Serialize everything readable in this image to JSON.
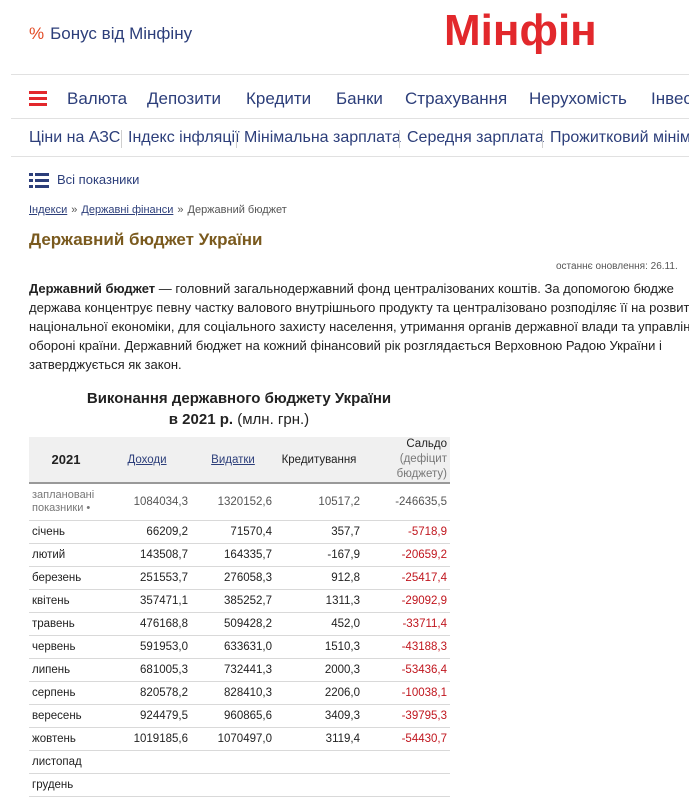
{
  "header": {
    "bonus_symbol": "%",
    "bonus_label": "Бонус від Мінфіну",
    "logo": "Мінфін",
    "brand_color": "#e2282c"
  },
  "nav_primary": [
    "Валюта",
    "Депозити",
    "Кредити",
    "Банки",
    "Страхування",
    "Нерухомість",
    "Інвес"
  ],
  "nav_secondary": [
    "Ціни на АЗС",
    "Індекс інфляції",
    "Мінімальна зарплата",
    "Середня зарплата",
    "Прожитковий мінім"
  ],
  "all_indicators": "Всі показники",
  "breadcrumbs": [
    "Індекси",
    "Державні фінанси",
    "Державний бюджет"
  ],
  "breadcrumb_sep": "»",
  "page_title": "Державний бюджет України",
  "updated": "останнє оновлення: 26.11.",
  "description": {
    "term": "Державний бюджет",
    "text_1": " — головний загальнодержавний фонд централізованих коштів. За допомогою бюдже",
    "text_2": "держава концентрує певну частку валового внутрішнього продукту та централізовано розподіляє її на розвито",
    "text_3": "національної економіки, для соціального захисту населення, утримання органів державної влади та управлінн",
    "text_4": "обороні країни. Державний бюджет на кожний фінансовий рік розглядається Верховною Радою України і",
    "text_5": "затверджується як закон."
  },
  "table": {
    "caption_line1": "Виконання державного бюджету України",
    "caption_line2": "в 2021 р.",
    "caption_unit": "(млн. грн.)",
    "headers": {
      "year": "2021",
      "income": "Доходи",
      "expenses": "Видатки",
      "credit": "Кредитування",
      "saldo": "Сальдо",
      "saldo_sub": "(дефіцит бюджету)"
    },
    "plan_row": {
      "label": "заплановані показники •",
      "income": "1084034,3",
      "expenses": "1320152,6",
      "credit": "10517,2",
      "saldo": "-246635,5"
    },
    "rows": [
      {
        "month": "січень",
        "income": "66209,2",
        "expenses": "71570,4",
        "credit": "357,7",
        "saldo": "-5718,9"
      },
      {
        "month": "лютий",
        "income": "143508,7",
        "expenses": "164335,7",
        "credit": "-167,9",
        "saldo": "-20659,2"
      },
      {
        "month": "березень",
        "income": "251553,7",
        "expenses": "276058,3",
        "credit": "912,8",
        "saldo": "-25417,4"
      },
      {
        "month": "квітень",
        "income": "357471,1",
        "expenses": "385252,7",
        "credit": "1311,3",
        "saldo": "-29092,9"
      },
      {
        "month": "травень",
        "income": "476168,8",
        "expenses": "509428,2",
        "credit": "452,0",
        "saldo": "-33711,4"
      },
      {
        "month": "червень",
        "income": "591953,0",
        "expenses": "633631,0",
        "credit": "1510,3",
        "saldo": "-43188,3"
      },
      {
        "month": "липень",
        "income": "681005,3",
        "expenses": "732441,3",
        "credit": "2000,3",
        "saldo": "-53436,4"
      },
      {
        "month": "серпень",
        "income": "820578,2",
        "expenses": "828410,3",
        "credit": "2206,0",
        "saldo": "-10038,1"
      },
      {
        "month": "вересень",
        "income": "924479,5",
        "expenses": "960865,6",
        "credit": "3409,3",
        "saldo": "-39795,3"
      },
      {
        "month": "жовтень",
        "income": "1019185,6",
        "expenses": "1070497,0",
        "credit": "3119,4",
        "saldo": "-54430,7"
      },
      {
        "month": "листопад",
        "income": "",
        "expenses": "",
        "credit": "",
        "saldo": ""
      },
      {
        "month": "грудень",
        "income": "",
        "expenses": "",
        "credit": "",
        "saldo": ""
      }
    ],
    "negative_color": "#c0161e"
  }
}
